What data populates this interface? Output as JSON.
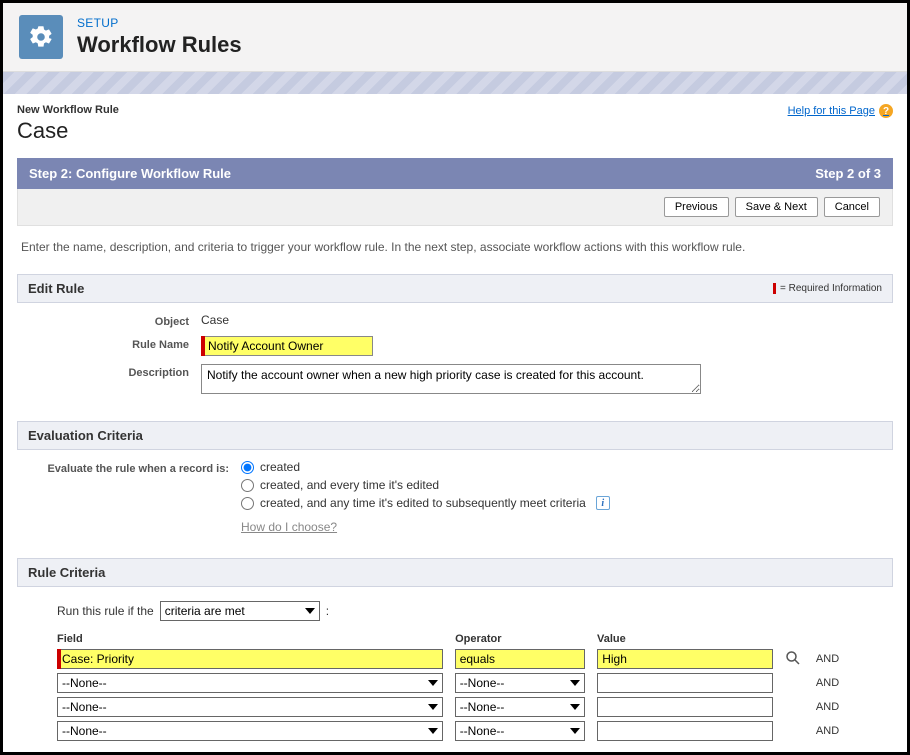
{
  "header": {
    "setup_label": "SETUP",
    "title": "Workflow Rules"
  },
  "breadcrumb": "New Workflow Rule",
  "entity": "Case",
  "help_link": "Help for this Page",
  "step_bar": {
    "title": "Step 2: Configure Workflow Rule",
    "progress": "Step 2 of 3"
  },
  "buttons": {
    "previous": "Previous",
    "save_next": "Save & Next",
    "cancel": "Cancel"
  },
  "instructions": "Enter the name, description, and criteria to trigger your workflow rule. In the next step, associate workflow actions with this workflow rule.",
  "edit_rule": {
    "section_title": "Edit Rule",
    "required_legend": "= Required Information",
    "object_label": "Object",
    "object_value": "Case",
    "rule_name_label": "Rule Name",
    "rule_name_value": "Notify Account Owner",
    "description_label": "Description",
    "description_value": "Notify the account owner when a new high priority case is created for this account."
  },
  "evaluation": {
    "section_title": "Evaluation Criteria",
    "prompt": "Evaluate the rule when a record is:",
    "options": {
      "created": "created",
      "created_edited": "created, and every time it's edited",
      "created_subsequent": "created, and any time it's edited to subsequently meet criteria"
    },
    "selected": "created",
    "choose_link": "How do I choose?"
  },
  "rule_criteria": {
    "section_title": "Rule Criteria",
    "run_label_pre": "Run this rule if the",
    "run_select": "criteria are met",
    "run_label_post": ":",
    "headers": {
      "field": "Field",
      "operator": "Operator",
      "value": "Value"
    },
    "and_label": "AND",
    "rows": [
      {
        "field": "Case: Priority",
        "operator": "equals",
        "value": "High",
        "highlight": true,
        "lookup": true
      },
      {
        "field": "--None--",
        "operator": "--None--",
        "value": "",
        "highlight": false,
        "lookup": false
      },
      {
        "field": "--None--",
        "operator": "--None--",
        "value": "",
        "highlight": false,
        "lookup": false
      },
      {
        "field": "--None--",
        "operator": "--None--",
        "value": "",
        "highlight": false,
        "lookup": false
      }
    ]
  }
}
